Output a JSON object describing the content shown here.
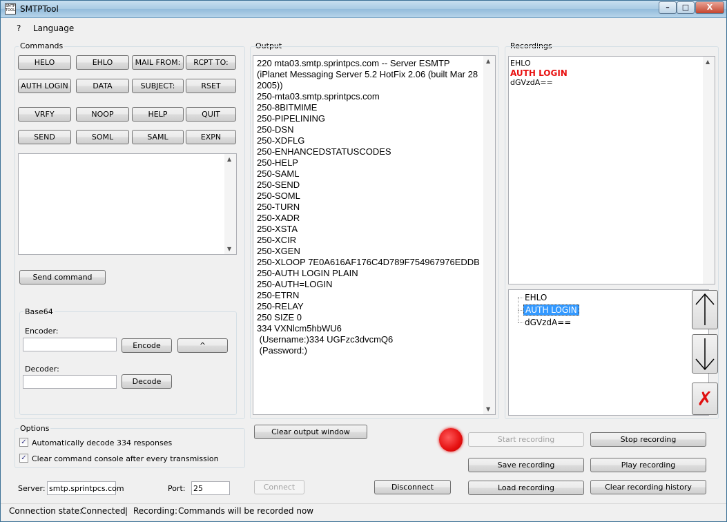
{
  "window": {
    "title": "SMTPTool",
    "icon_text": "SMTP TOOL",
    "minimize": "–",
    "maximize": "□",
    "close": "X"
  },
  "menu": {
    "help": "?",
    "language": "Language"
  },
  "commands": {
    "label": "Commands",
    "buttons": [
      "HELO",
      "EHLO",
      "MAIL FROM:",
      "RCPT TO:",
      "AUTH LOGIN",
      "DATA",
      "SUBJECT:",
      "RSET",
      "VRFY",
      "NOOP",
      "HELP",
      "QUIT",
      "SEND",
      "SOML",
      "SAML",
      "EXPN"
    ],
    "console_value": "",
    "send_command": "Send command"
  },
  "base64": {
    "label": "Base64",
    "encoder_label": "Encoder:",
    "encoder_value": "",
    "encode_button": "Encode",
    "swap_button": "^",
    "decoder_label": "Decoder:",
    "decoder_value": "",
    "decode_button": "Decode"
  },
  "options": {
    "label": "Options",
    "auto_decode": "Automatically decode 334 responses",
    "auto_decode_checked": true,
    "clear_console": "Clear command console after every transmission",
    "clear_console_checked": true
  },
  "connection": {
    "server_label": "Server:",
    "server_value": "smtp.sprintpcs.com",
    "port_label": "Port:",
    "port_value": "25",
    "connect": "Connect",
    "disconnect": "Disconnect"
  },
  "output": {
    "label": "Output",
    "lines": [
      "220 mta03.smtp.sprintpcs.com -- Server ESMTP",
      "(iPlanet Messaging Server 5.2 HotFix 2.06 (built Mar 28",
      "2005))",
      "250-mta03.smtp.sprintpcs.com",
      "250-8BITMIME",
      "250-PIPELINING",
      "250-DSN",
      "250-XDFLG",
      "250-ENHANCEDSTATUSCODES",
      "250-HELP",
      "250-SAML",
      "250-SEND",
      "250-SOML",
      "250-TURN",
      "250-XADR",
      "250-XSTA",
      "250-XCIR",
      "250-XGEN",
      "250-XLOOP 7E0A616AF176C4D789F754967976EDDB",
      "250-AUTH LOGIN PLAIN",
      "250-AUTH=LOGIN",
      "250-ETRN",
      "250-RELAY",
      "250 SIZE 0",
      "334 VXNlcm5hbWU6",
      " (Username:)334 UGFzc3dvcmQ6",
      " (Password:)"
    ],
    "clear_button": "Clear output window"
  },
  "recordings": {
    "label": "Recordings",
    "text_lines": [
      "EHLO",
      "AUTH LOGIN",
      "dGVzdA=="
    ],
    "highlight_color": "#e81010",
    "tree_items": [
      "EHLO",
      "AUTH LOGIN",
      "dGVzdA=="
    ],
    "selected_index": 1,
    "move_up_icon": "up-arrow",
    "move_down_icon": "down-arrow",
    "delete_icon": "red-x",
    "delete_glyph": "✗",
    "start": "Start recording",
    "stop": "Stop recording",
    "save": "Save recording",
    "play": "Play recording",
    "load": "Load recording",
    "clear_history": "Clear recording history",
    "indicator_color": "#e51010"
  },
  "status": {
    "connection_label": "Connection state:",
    "connection_value": "Connected",
    "separator": "|",
    "recording_label": "Recording:",
    "recording_value": "Commands will be recorded now"
  }
}
